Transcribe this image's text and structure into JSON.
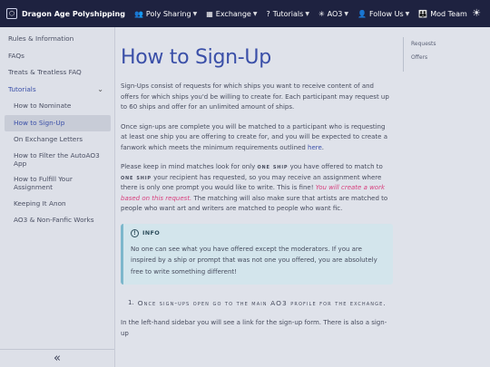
{
  "navbar": {
    "brand": "Dragon Age Polyshipping",
    "items": [
      {
        "label": "Poly Sharing",
        "icon": "users-icon",
        "has_dropdown": true
      },
      {
        "label": "Exchange",
        "icon": "building-icon",
        "has_dropdown": true
      },
      {
        "label": "Tutorials",
        "icon": "question-icon",
        "has_dropdown": true
      },
      {
        "label": "AO3",
        "icon": "ao3-icon",
        "has_dropdown": true
      },
      {
        "label": "Follow Us",
        "icon": "user-plus-icon",
        "has_dropdown": true
      },
      {
        "label": "Mod Team",
        "icon": "team-icon",
        "has_dropdown": false
      }
    ]
  },
  "sidebar": {
    "items": [
      {
        "label": "Rules & Information"
      },
      {
        "label": "FAQs"
      },
      {
        "label": "Treats & Treatless FAQ"
      },
      {
        "label": "Tutorials"
      }
    ],
    "tutorials": [
      {
        "label": "How to Nominate"
      },
      {
        "label": "How to Sign-Up"
      },
      {
        "label": "On Exchange Letters"
      },
      {
        "label": "How to Filter the AutoAO3 App"
      },
      {
        "label": "How to Fulfill Your Assignment"
      },
      {
        "label": "Keeping It Anon"
      },
      {
        "label": "AO3 & Non-Fanfic Works"
      }
    ],
    "collapse_glyph": "«"
  },
  "main": {
    "title": "How to Sign-Up",
    "p1": "Sign-Ups consist of requests for which ships you want to receive content of and offers for which ships you'd be willing to create for. Each participant may request up to 60 ships and offer for an unlimited amount of ships.",
    "p2_before": "Once sign-ups are complete you will be matched to a participant who is requesting at least one ship you are offering to create for, and you will be expected to create a fanwork which meets the minimum requirements outlined ",
    "p2_link": "here",
    "p2_after": ".",
    "p3_a": "Please keep in mind matches look for only ",
    "p3_sc1": "one ship",
    "p3_b": " you have offered to match to ",
    "p3_sc2": "one ship",
    "p3_c": " your recipient has requested, so you may receive an assignment where there is only one prompt you would like to write. This is fine! ",
    "p3_pink": "You will create a work based on this request.",
    "p3_d": " The matching will also make sure that artists are matched to people who want art and writers are matched to people who want fic.",
    "info_title": "INFO",
    "info_text": "No one can see what you have offered except the moderators. If you are inspired by a ship or prompt that was not one you offered, you are absolutely free to write something different!",
    "step1_num": "1.",
    "step1_text": "Once sign-ups open go to the main AO3 profile for the exchange.",
    "p4": "In the left-hand sidebar you will see a link for the sign-up form. There is also a sign-up"
  },
  "toc": {
    "items": [
      "Requests",
      "Offers"
    ]
  }
}
